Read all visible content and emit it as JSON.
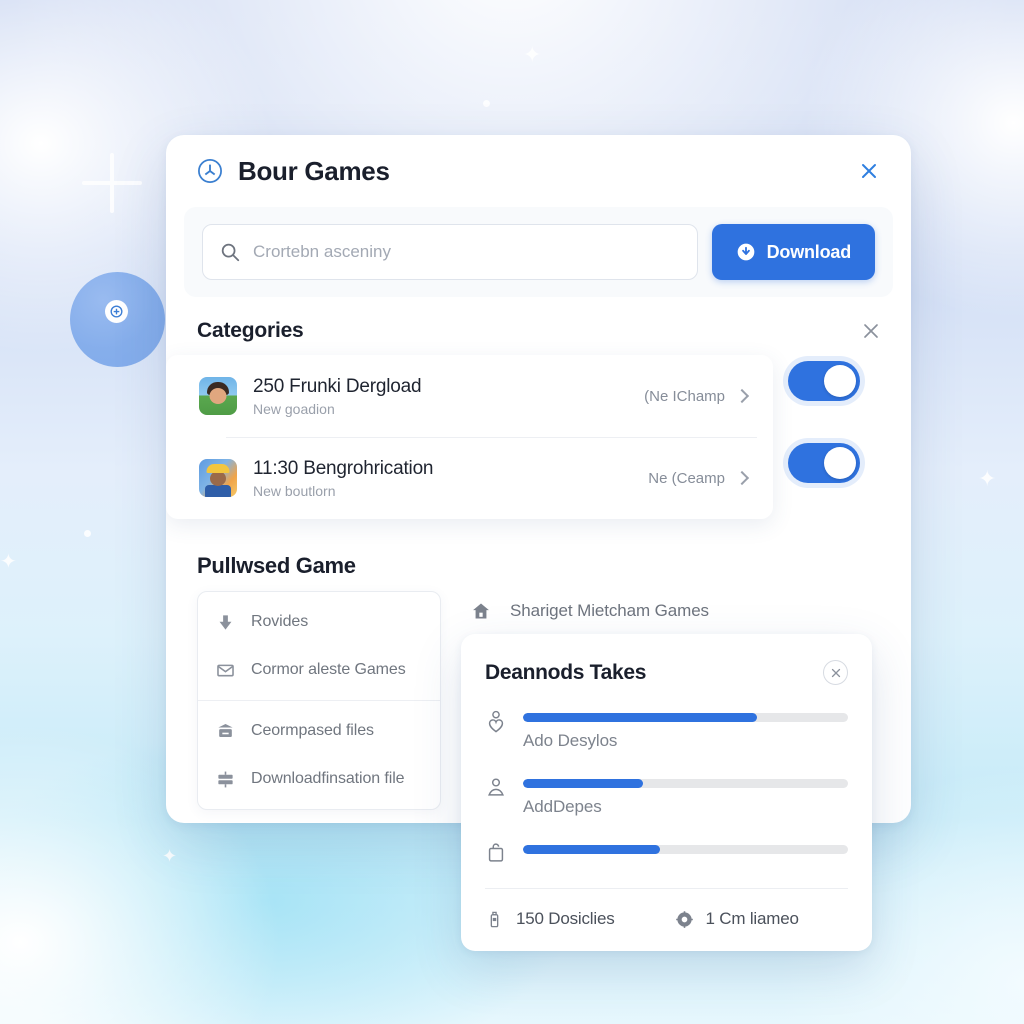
{
  "window": {
    "brand_icon": "clock-circle-icon",
    "title": "Bour Games",
    "close_icon": "close-icon",
    "accent_color": "#2f72df"
  },
  "search": {
    "icon": "search-icon",
    "placeholder": "Crortebn asceniny",
    "value": "",
    "download_button": {
      "label": "Download",
      "icon": "download-badge-icon"
    }
  },
  "categories": {
    "heading": "Categories",
    "close_icon": "close-icon",
    "rows": [
      {
        "thumb": "avatar-thumbnail",
        "name": "250 Frunki Dergload",
        "sub": "New goadion",
        "meta": "(Ne IChamp",
        "chevron": "chevron-right-icon",
        "toggle_on": true
      },
      {
        "thumb": "avatar-thumbnail",
        "name": "11:30 Bengrohrication",
        "sub": "New boutlorn",
        "meta": "Ne (Ceamp",
        "chevron": "chevron-right-icon",
        "toggle_on": true
      }
    ]
  },
  "featured": {
    "heading": "Pullwsed Game",
    "menu_groups": [
      {
        "items": [
          {
            "icon": "download-arrow-icon",
            "label": "Rovides"
          },
          {
            "icon": "envelope-icon",
            "label": "Cormor aleste Games"
          }
        ]
      },
      {
        "items": [
          {
            "icon": "archive-box-icon",
            "label": "Ceormpased files"
          },
          {
            "icon": "server-icon",
            "label": "Downloadfinsation file"
          }
        ]
      }
    ],
    "side_link": {
      "icon": "home-icon",
      "label": "Shariget Mietcham Games"
    }
  },
  "stats_card": {
    "title": "Deannods Takes",
    "close_icon": "close-icon",
    "bars": [
      {
        "icon": "person-heart-icon",
        "label": "Ado Desylos",
        "percent": 72
      },
      {
        "icon": "person-icon",
        "label": "AddDepes",
        "percent": 37
      },
      {
        "icon": "bag-icon",
        "label": "",
        "percent": 42
      }
    ],
    "footer": [
      {
        "icon": "bottle-icon",
        "label": "150 Dosiclies"
      },
      {
        "icon": "target-icon",
        "label": "1 Cm liameo"
      }
    ]
  },
  "decorations": {
    "plus": "plus-mark",
    "orb": "blue-orb",
    "sparkles": [
      "sparkle",
      "sparkle",
      "sparkle",
      "sparkle"
    ]
  }
}
